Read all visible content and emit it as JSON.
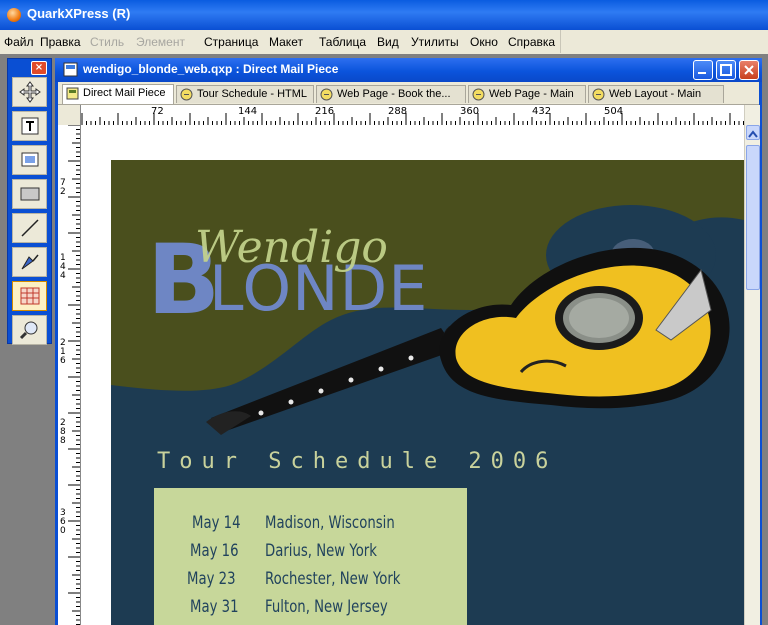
{
  "app": {
    "title": "QuarkXPress (R)"
  },
  "menu": [
    {
      "label": "Файл",
      "enabled": true
    },
    {
      "label": "Правка",
      "enabled": true
    },
    {
      "label": "Стиль",
      "enabled": false
    },
    {
      "label": "Элемент",
      "enabled": false
    },
    {
      "label": "Страница",
      "enabled": true
    },
    {
      "label": "Макет",
      "enabled": true
    },
    {
      "label": "Таблица",
      "enabled": true
    },
    {
      "label": "Вид",
      "enabled": true
    },
    {
      "label": "Утилиты",
      "enabled": true
    },
    {
      "label": "Окно",
      "enabled": true
    },
    {
      "label": "Справка",
      "enabled": true
    }
  ],
  "tools": [
    {
      "name": "item-tool",
      "icon": "move-arrows-icon"
    },
    {
      "name": "text-content-tool",
      "icon": "text-icon"
    },
    {
      "name": "picture-content-tool",
      "icon": "picture-icon"
    },
    {
      "name": "rectangle-box-tool",
      "icon": "rectangle-icon"
    },
    {
      "name": "line-tool",
      "icon": "line-icon"
    },
    {
      "name": "bezier-pen-tool",
      "icon": "pen-icon"
    },
    {
      "name": "table-tool",
      "icon": "table-icon",
      "selected": true
    },
    {
      "name": "zoom-tool",
      "icon": "magnifier-icon"
    }
  ],
  "document": {
    "title": "wendigo_blonde_web.qxp : Direct Mail Piece",
    "tabs": [
      {
        "label": "Direct Mail Piece",
        "active": true,
        "icon": "page-icon"
      },
      {
        "label": "Tour Schedule - HTML",
        "active": false,
        "icon": "web-icon"
      },
      {
        "label": "Web Page - Book the...",
        "active": false,
        "icon": "web-icon"
      },
      {
        "label": "Web Page - Main",
        "active": false,
        "icon": "web-icon"
      },
      {
        "label": "Web Layout - Main",
        "active": false,
        "icon": "web-icon"
      }
    ],
    "ruler_h_labels": [
      "72",
      "144",
      "216",
      "288",
      "360",
      "432",
      "504"
    ],
    "ruler_v_labels": [
      "72",
      "144",
      "216",
      "288",
      "360"
    ]
  },
  "poster": {
    "band_name_script": "Wendigo",
    "band_name_block": "BLONDE",
    "schedule_heading": "Tour Schedule 2006",
    "schedule": [
      {
        "date": "May 14",
        "city": "Madison, Wisconsin"
      },
      {
        "date": "May 16",
        "city": "Darius, New York"
      },
      {
        "date": "May 23",
        "city": "Rochester, New York"
      },
      {
        "date": "May 31",
        "city": "Fulton, New Jersey"
      }
    ]
  },
  "colors": {
    "poster_background": "#1d3b52",
    "olive_band": "#4a4f1d",
    "schedule_box": "#c7d79a",
    "schedule_text": "#21435d",
    "blonde_text": "#6e86c4",
    "script_text": "#c4d48c",
    "guitar_body": "#f0c020"
  }
}
